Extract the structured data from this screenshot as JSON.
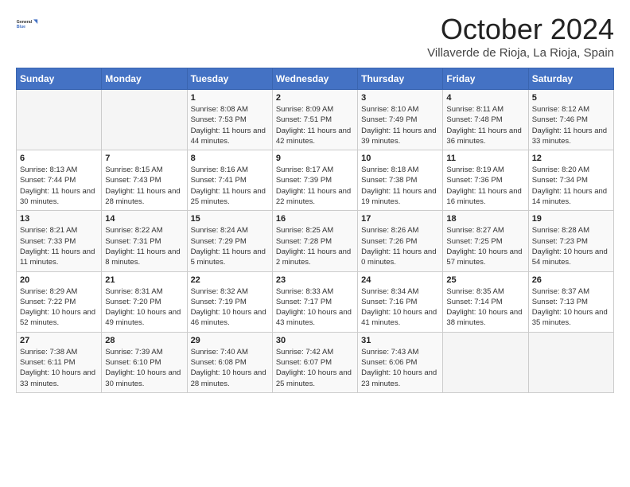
{
  "logo": {
    "line1": "General",
    "line2": "Blue"
  },
  "header": {
    "month": "October 2024",
    "location": "Villaverde de Rioja, La Rioja, Spain"
  },
  "weekdays": [
    "Sunday",
    "Monday",
    "Tuesday",
    "Wednesday",
    "Thursday",
    "Friday",
    "Saturday"
  ],
  "weeks": [
    [
      {
        "day": "",
        "info": ""
      },
      {
        "day": "",
        "info": ""
      },
      {
        "day": "1",
        "info": "Sunrise: 8:08 AM\nSunset: 7:53 PM\nDaylight: 11 hours and 44 minutes."
      },
      {
        "day": "2",
        "info": "Sunrise: 8:09 AM\nSunset: 7:51 PM\nDaylight: 11 hours and 42 minutes."
      },
      {
        "day": "3",
        "info": "Sunrise: 8:10 AM\nSunset: 7:49 PM\nDaylight: 11 hours and 39 minutes."
      },
      {
        "day": "4",
        "info": "Sunrise: 8:11 AM\nSunset: 7:48 PM\nDaylight: 11 hours and 36 minutes."
      },
      {
        "day": "5",
        "info": "Sunrise: 8:12 AM\nSunset: 7:46 PM\nDaylight: 11 hours and 33 minutes."
      }
    ],
    [
      {
        "day": "6",
        "info": "Sunrise: 8:13 AM\nSunset: 7:44 PM\nDaylight: 11 hours and 30 minutes."
      },
      {
        "day": "7",
        "info": "Sunrise: 8:15 AM\nSunset: 7:43 PM\nDaylight: 11 hours and 28 minutes."
      },
      {
        "day": "8",
        "info": "Sunrise: 8:16 AM\nSunset: 7:41 PM\nDaylight: 11 hours and 25 minutes."
      },
      {
        "day": "9",
        "info": "Sunrise: 8:17 AM\nSunset: 7:39 PM\nDaylight: 11 hours and 22 minutes."
      },
      {
        "day": "10",
        "info": "Sunrise: 8:18 AM\nSunset: 7:38 PM\nDaylight: 11 hours and 19 minutes."
      },
      {
        "day": "11",
        "info": "Sunrise: 8:19 AM\nSunset: 7:36 PM\nDaylight: 11 hours and 16 minutes."
      },
      {
        "day": "12",
        "info": "Sunrise: 8:20 AM\nSunset: 7:34 PM\nDaylight: 11 hours and 14 minutes."
      }
    ],
    [
      {
        "day": "13",
        "info": "Sunrise: 8:21 AM\nSunset: 7:33 PM\nDaylight: 11 hours and 11 minutes."
      },
      {
        "day": "14",
        "info": "Sunrise: 8:22 AM\nSunset: 7:31 PM\nDaylight: 11 hours and 8 minutes."
      },
      {
        "day": "15",
        "info": "Sunrise: 8:24 AM\nSunset: 7:29 PM\nDaylight: 11 hours and 5 minutes."
      },
      {
        "day": "16",
        "info": "Sunrise: 8:25 AM\nSunset: 7:28 PM\nDaylight: 11 hours and 2 minutes."
      },
      {
        "day": "17",
        "info": "Sunrise: 8:26 AM\nSunset: 7:26 PM\nDaylight: 11 hours and 0 minutes."
      },
      {
        "day": "18",
        "info": "Sunrise: 8:27 AM\nSunset: 7:25 PM\nDaylight: 10 hours and 57 minutes."
      },
      {
        "day": "19",
        "info": "Sunrise: 8:28 AM\nSunset: 7:23 PM\nDaylight: 10 hours and 54 minutes."
      }
    ],
    [
      {
        "day": "20",
        "info": "Sunrise: 8:29 AM\nSunset: 7:22 PM\nDaylight: 10 hours and 52 minutes."
      },
      {
        "day": "21",
        "info": "Sunrise: 8:31 AM\nSunset: 7:20 PM\nDaylight: 10 hours and 49 minutes."
      },
      {
        "day": "22",
        "info": "Sunrise: 8:32 AM\nSunset: 7:19 PM\nDaylight: 10 hours and 46 minutes."
      },
      {
        "day": "23",
        "info": "Sunrise: 8:33 AM\nSunset: 7:17 PM\nDaylight: 10 hours and 43 minutes."
      },
      {
        "day": "24",
        "info": "Sunrise: 8:34 AM\nSunset: 7:16 PM\nDaylight: 10 hours and 41 minutes."
      },
      {
        "day": "25",
        "info": "Sunrise: 8:35 AM\nSunset: 7:14 PM\nDaylight: 10 hours and 38 minutes."
      },
      {
        "day": "26",
        "info": "Sunrise: 8:37 AM\nSunset: 7:13 PM\nDaylight: 10 hours and 35 minutes."
      }
    ],
    [
      {
        "day": "27",
        "info": "Sunrise: 7:38 AM\nSunset: 6:11 PM\nDaylight: 10 hours and 33 minutes."
      },
      {
        "day": "28",
        "info": "Sunrise: 7:39 AM\nSunset: 6:10 PM\nDaylight: 10 hours and 30 minutes."
      },
      {
        "day": "29",
        "info": "Sunrise: 7:40 AM\nSunset: 6:08 PM\nDaylight: 10 hours and 28 minutes."
      },
      {
        "day": "30",
        "info": "Sunrise: 7:42 AM\nSunset: 6:07 PM\nDaylight: 10 hours and 25 minutes."
      },
      {
        "day": "31",
        "info": "Sunrise: 7:43 AM\nSunset: 6:06 PM\nDaylight: 10 hours and 23 minutes."
      },
      {
        "day": "",
        "info": ""
      },
      {
        "day": "",
        "info": ""
      }
    ]
  ]
}
